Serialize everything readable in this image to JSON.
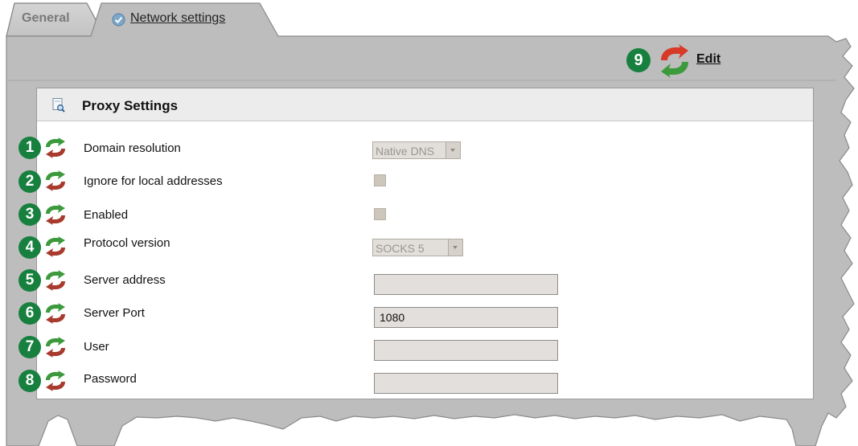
{
  "tabs": {
    "general": "General",
    "network": "Network settings"
  },
  "toolbar": {
    "edit_label": "Edit",
    "edit_badge": "9"
  },
  "section": {
    "title": "Proxy Settings"
  },
  "rows": [
    {
      "badge": "1",
      "label": "Domain resolution",
      "control": "select",
      "value": "Native DNS"
    },
    {
      "badge": "2",
      "label": "Ignore for local addresses",
      "control": "checkbox",
      "checked": false
    },
    {
      "badge": "3",
      "label": "Enabled",
      "control": "checkbox",
      "checked": false
    },
    {
      "badge": "4",
      "label": "Protocol version",
      "control": "select",
      "value": "SOCKS 5"
    },
    {
      "badge": "5",
      "label": "Server address",
      "control": "text",
      "value": ""
    },
    {
      "badge": "6",
      "label": "Server Port",
      "control": "text",
      "value": "1080"
    },
    {
      "badge": "7",
      "label": "User",
      "control": "text",
      "value": ""
    },
    {
      "badge": "8",
      "label": "Password",
      "control": "text",
      "value": ""
    }
  ],
  "colors": {
    "panel_gray": "#bcbcbc",
    "badge_green": "#17803f",
    "section_header_bg": "#ececec"
  },
  "icons": {
    "tab_check": "check-circle-icon",
    "refresh": "refresh-icon",
    "section": "search-page-icon"
  }
}
